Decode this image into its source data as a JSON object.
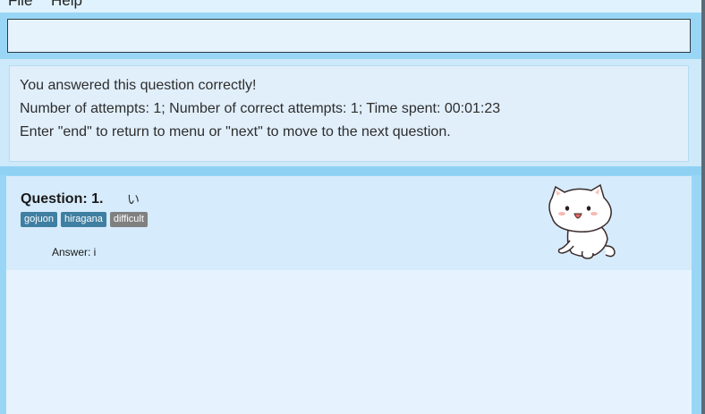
{
  "menu": {
    "file": "File",
    "help": "Help"
  },
  "command": {
    "value": "",
    "placeholder": ""
  },
  "result": {
    "lines": [
      "You answered this question correctly!",
      "Number of attempts: 1; Number of correct attempts: 1; Time spent: 00:01:23",
      "Enter \"end\" to return to menu or \"next\" to move to the next question."
    ]
  },
  "question": {
    "title": "Question: 1.",
    "kana": "い",
    "tags": [
      {
        "label": "gojuon",
        "color": "#3f7fa1"
      },
      {
        "label": "hiragana",
        "color": "#3f7fa1"
      },
      {
        "label": "difficult",
        "color": "#808080"
      }
    ],
    "answer": "Answer: i"
  },
  "mascot": {
    "icon": "cat-mascot-icon"
  },
  "colors": {
    "accent": "#99d6f5",
    "panel": "#e6f3fe",
    "card": "#d6ebfb",
    "tag_blue": "#3f7fa1",
    "tag_gray": "#808080"
  }
}
